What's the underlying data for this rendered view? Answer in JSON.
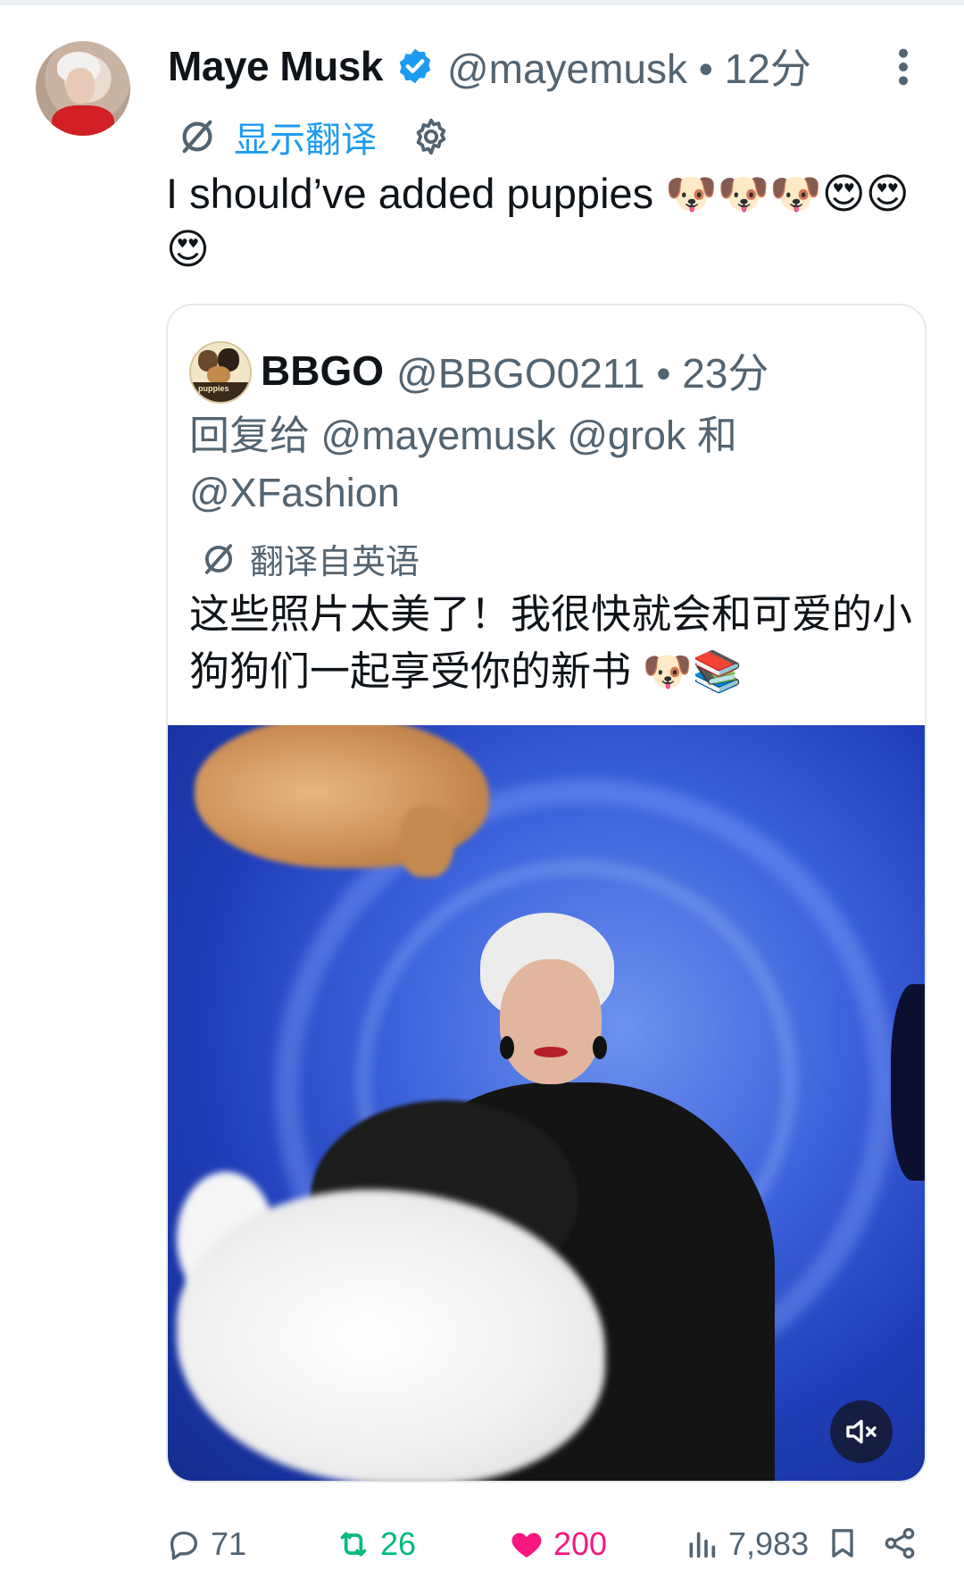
{
  "tweet": {
    "author_name": "Maye Musk",
    "handle_time": "@mayemusk • 12分",
    "translate_label": "显示翻译",
    "text": "I should’ve added puppies 🐶🐶🐶😍😍😍"
  },
  "quote": {
    "author_name": "BBGO",
    "handle_time": "@BBGO0211 • 23分",
    "avatar_label": "puppies",
    "reply_to": "回复给 @mayemusk @grok 和 @XFashion",
    "translated_label": "翻译自英语",
    "text": "这些照片太美了！我很快就会和可爱的小狗狗们一起享受你的新书 🐶📚"
  },
  "actions": {
    "replies": "71",
    "reposts": "26",
    "likes": "200",
    "views": "7,983"
  },
  "colors": {
    "accent": "#1d9bf0",
    "muted": "#536471",
    "repost": "#00ba7c",
    "like": "#f91880"
  },
  "icons": [
    "verified-badge-icon",
    "more-options-icon",
    "translate-icon",
    "gear-icon",
    "mute-icon",
    "reply-icon",
    "repost-icon",
    "like-icon",
    "views-icon",
    "bookmark-icon",
    "share-icon"
  ]
}
